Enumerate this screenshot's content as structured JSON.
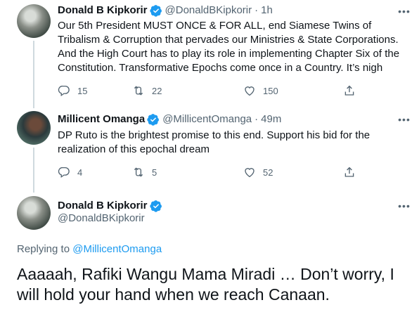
{
  "tweets": [
    {
      "name": "Donald B Kipkorir",
      "handle": "@DonaldBKipkorir",
      "time": "1h",
      "text": "Our 5th President MUST ONCE & FOR ALL, end Siamese Twins of Tribalism & Corruption that pervades our Ministries & State Corporations. And the High Court has to play its role in implementing Chapter Six of the Constitution. Transformative Epochs come once in a Country. It’s nigh",
      "replies": "15",
      "retweets": "22",
      "likes": "150"
    },
    {
      "name": "Millicent Omanga",
      "handle": "@MillicentOmanga",
      "time": "49m",
      "text": "DP Ruto is the brightest promise to this end. Support his bid for the realization of this epochal dream",
      "replies": "4",
      "retweets": "5",
      "likes": "52"
    }
  ],
  "main_tweet": {
    "name": "Donald B Kipkorir",
    "handle": "@DonaldBKipkorir",
    "replying_prefix": "Replying to",
    "replying_to": "@MillicentOmanga",
    "text": "Aaaaah, Rafiki Wangu Mama Miradi … Don’t worry, I will hold your hand when we reach Canaan."
  },
  "separator_dot": "·",
  "more_glyph": "•••",
  "icons": [
    "verified-badge-icon",
    "reply-icon",
    "retweet-icon",
    "like-icon",
    "share-icon",
    "more-icon"
  ],
  "colors": {
    "accent": "#1d9bf0",
    "muted": "#536471",
    "text": "#0f1419",
    "thread_line": "#cfd9de"
  }
}
